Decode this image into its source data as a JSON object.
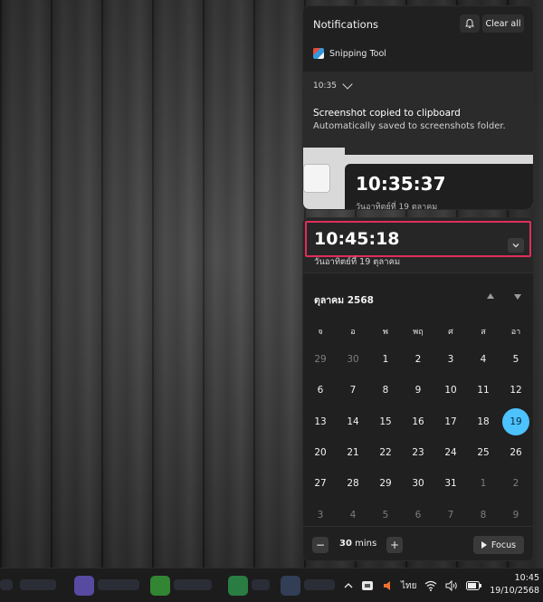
{
  "notifications": {
    "header": "Notifications",
    "clear_all": "Clear all",
    "app_name": "Snipping Tool",
    "time": "10:35",
    "title": "Screenshot copied to clipboard",
    "body": "Automatically saved to screenshots folder.",
    "thumbnail_clock": "10:35:37",
    "thumbnail_date": "วันอาทิตย์ที่ 19 ตุลาคม"
  },
  "calendar": {
    "clock": "10:45:18",
    "date_text": "วันอาทิตย์ที่ 19 ตุลาคม",
    "month_label": "ตุลาคม 2568",
    "weekdays": [
      "จ",
      "อ",
      "พ",
      "พฤ",
      "ศ",
      "ส",
      "อา"
    ],
    "weeks": [
      [
        {
          "d": "29",
          "muted": true
        },
        {
          "d": "30",
          "muted": true
        },
        {
          "d": "1"
        },
        {
          "d": "2"
        },
        {
          "d": "3"
        },
        {
          "d": "4"
        },
        {
          "d": "5"
        }
      ],
      [
        {
          "d": "6"
        },
        {
          "d": "7"
        },
        {
          "d": "8"
        },
        {
          "d": "9"
        },
        {
          "d": "10"
        },
        {
          "d": "11"
        },
        {
          "d": "12"
        }
      ],
      [
        {
          "d": "13"
        },
        {
          "d": "14"
        },
        {
          "d": "15"
        },
        {
          "d": "16"
        },
        {
          "d": "17"
        },
        {
          "d": "18"
        },
        {
          "d": "19",
          "today": true
        }
      ],
      [
        {
          "d": "20"
        },
        {
          "d": "21"
        },
        {
          "d": "22"
        },
        {
          "d": "23"
        },
        {
          "d": "24"
        },
        {
          "d": "25"
        },
        {
          "d": "26"
        }
      ],
      [
        {
          "d": "27"
        },
        {
          "d": "28"
        },
        {
          "d": "29"
        },
        {
          "d": "30"
        },
        {
          "d": "31"
        },
        {
          "d": "1",
          "muted": true
        },
        {
          "d": "2",
          "muted": true
        }
      ],
      [
        {
          "d": "3",
          "muted": true
        },
        {
          "d": "4",
          "muted": true
        },
        {
          "d": "5",
          "muted": true
        },
        {
          "d": "6",
          "muted": true
        },
        {
          "d": "7",
          "muted": true
        },
        {
          "d": "8",
          "muted": true
        },
        {
          "d": "9",
          "muted": true
        }
      ]
    ],
    "today_color": "#4cc2ff",
    "highlight_color": "#e02d5a"
  },
  "focus": {
    "minutes_value": "30",
    "minutes_unit": "mins",
    "minus": "−",
    "plus": "+",
    "button_label": "Focus"
  },
  "taskbar": {
    "language": "ไทย",
    "time": "10:45",
    "date": "19/10/2568",
    "icons": [
      "chevron-up-icon",
      "app-tray-icon",
      "volume-alert-icon",
      "wifi-icon",
      "speaker-icon",
      "battery-icon"
    ]
  }
}
